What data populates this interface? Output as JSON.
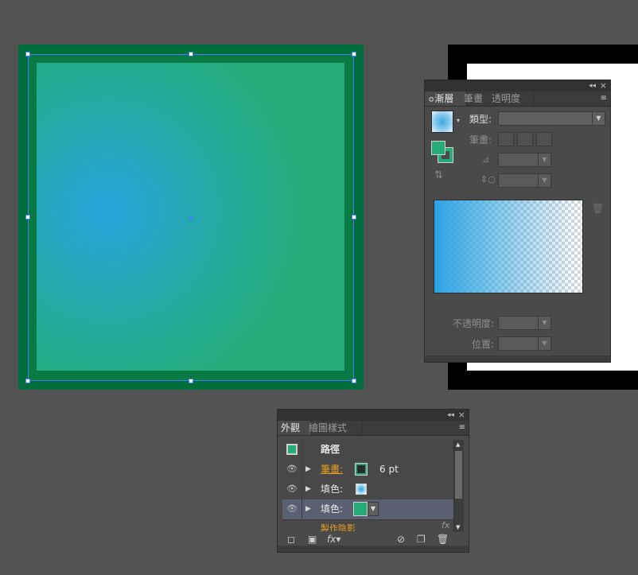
{
  "gradient_panel": {
    "tabs": [
      {
        "label": "漸層",
        "active": true
      },
      {
        "label": "筆畫",
        "active": false
      },
      {
        "label": "透明度",
        "active": false
      }
    ],
    "tab_prefix": "≎",
    "menu_icon": "≡",
    "collapse_icon": "◂◂",
    "close_icon": "×",
    "type_label": "類型:",
    "type_value": "",
    "stroke_label": "筆畫:",
    "opacity_label": "不透明度:",
    "location_label": "位置:",
    "angle_icon": "angle-icon",
    "aspect_icon": "aspect-ratio-icon",
    "trash_icon": "trash-icon",
    "swatch_colors": {
      "fill": "#25ac78",
      "stroke": "#25ac78"
    },
    "gradient_color": "#2ca3e3"
  },
  "appearance_panel": {
    "tabs": [
      {
        "label": "外觀",
        "active": true
      },
      {
        "label": "繪圖樣式",
        "active": false
      }
    ],
    "menu_icon": "≡",
    "collapse_icon": "◂◂",
    "close_icon": "×",
    "title": "路徑",
    "rows": [
      {
        "label": "筆畫:",
        "value": "6 pt",
        "swatch": "#25ac78",
        "link": true
      },
      {
        "label": "填色:",
        "swatch": "gradient",
        "link": false
      },
      {
        "label": "填色:",
        "swatch": "#25ac78",
        "link": false,
        "selected": true
      }
    ],
    "partial_row_label": "製作陰影",
    "fx_label": "fx",
    "footer_icons": [
      "new-art-icon",
      "clear-appearance-icon",
      "fx-icon",
      "no-icon",
      "duplicate-icon",
      "trash-icon"
    ]
  },
  "canvas": {
    "object_fill_colors": [
      "#27a4dc",
      "#25ac78"
    ],
    "object_stroke_color": "#006e3c",
    "selection_color": "#4a7cff"
  }
}
